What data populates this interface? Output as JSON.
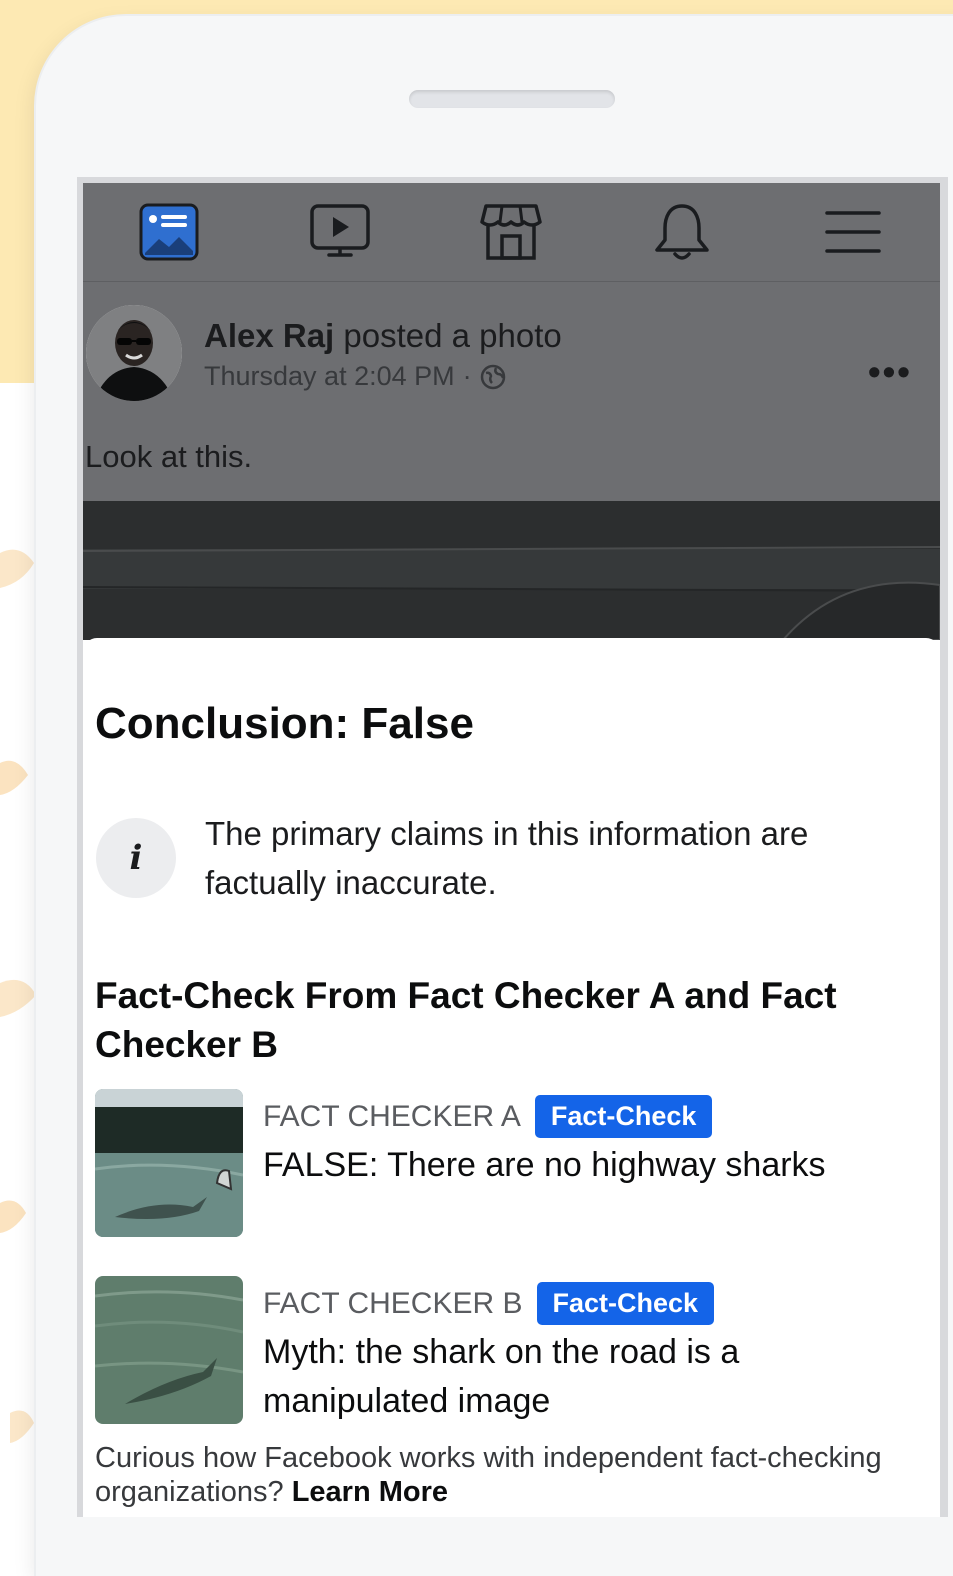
{
  "colors": {
    "background_yellow": "#fde9b3",
    "phone_body": "#f6f7f8",
    "overlay_dim": "#6d6e71",
    "badge_blue": "#1464e8",
    "feed_icon_blue": "#2f6fd0"
  },
  "navbar": {
    "items": [
      {
        "icon": "news-feed-icon"
      },
      {
        "icon": "watch-video-icon"
      },
      {
        "icon": "marketplace-icon"
      },
      {
        "icon": "notifications-bell-icon"
      },
      {
        "icon": "menu-hamburger-icon"
      }
    ]
  },
  "post": {
    "author": "Alex Raj",
    "action": "posted a photo",
    "timestamp": "Thursday at 2:04 PM",
    "separator": "·",
    "privacy_icon": "globe-icon",
    "more_label": "•••",
    "text": "Look at this."
  },
  "sheet": {
    "conclusion": "Conclusion: False",
    "info_icon_label": "i",
    "info_text": "The primary claims in this information are factually inaccurate.",
    "fact_check_heading": "Fact-Check From Fact Checker A and Fact Checker B",
    "items": [
      {
        "source": "FACT CHECKER A",
        "badge": "Fact-Check",
        "title": "FALSE: There are no highway sharks"
      },
      {
        "source": "FACT CHECKER B",
        "badge": "Fact-Check",
        "title": "Myth: the shark on the road is a manipulated image"
      }
    ],
    "footer_text": "Curious how Facebook works with independent fact-checking organizations?",
    "footer_link": "Learn More"
  }
}
